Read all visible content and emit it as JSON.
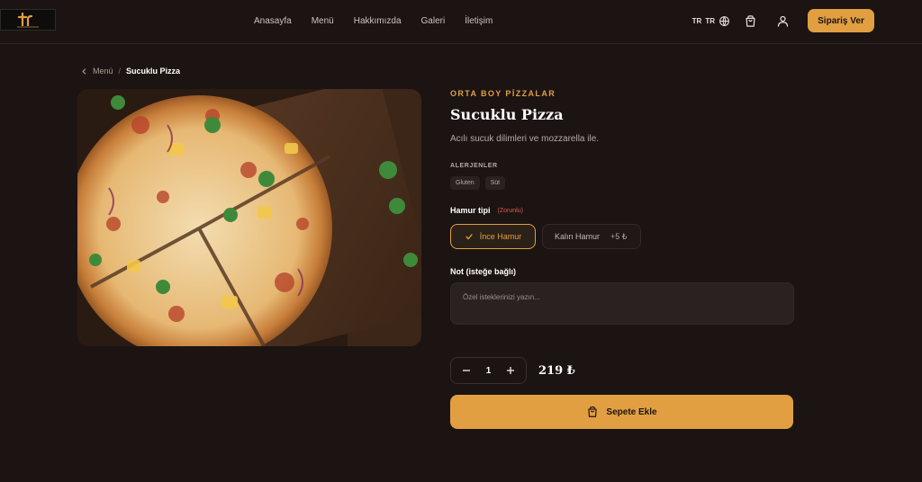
{
  "colors": {
    "accent": "#e19f41",
    "background": "#1b1412",
    "required": "#e05a4f"
  },
  "header": {
    "logo_icon": "restaurant-logo",
    "nav": [
      "Anasayfa",
      "Menü",
      "Hakkımızda",
      "Galeri",
      "İletişim"
    ],
    "lang": [
      "TR",
      "TR"
    ],
    "icons": [
      "globe-icon",
      "cart-icon",
      "user-icon"
    ],
    "order_button": "Sipariş Ver"
  },
  "breadcrumb": {
    "back": "Menü",
    "separator": "/",
    "current": "Sucuklu Pizza"
  },
  "product": {
    "image": "pizza-photo",
    "category": "ORTA BOY PİZZALAR",
    "name": "Sucuklu Pizza",
    "description": "Acılı sucuk dilimleri ve mozzarella ile.",
    "allergens_label": "ALERJENLER",
    "allergens": [
      "Gluten",
      "Süt"
    ],
    "dough_label": "Hamur tipi",
    "dough_required": "(Zorunlu)",
    "dough_options": [
      {
        "label": "İnce Hamur",
        "selected": true
      },
      {
        "label": "Kalın Hamur",
        "price": "+5 ₺",
        "selected": false
      }
    ],
    "note_label": "Not (isteğe bağlı)",
    "note_placeholder": "Özel isteklerinizi yazın...",
    "quantity": "1",
    "price": "219 ₺",
    "add_to_cart": "Sepete Ekle"
  }
}
